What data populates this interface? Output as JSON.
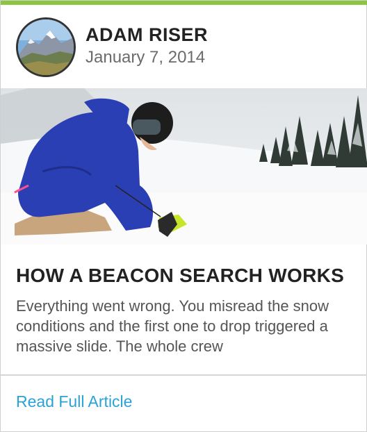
{
  "author": {
    "name": "ADAM RISER",
    "date": "January 7, 2014",
    "avatar_icon": "mountain-photo-avatar"
  },
  "post": {
    "hero_image": "skier-using-avalanche-beacon-photo",
    "title": "HOW A BEACON SEARCH WORKS",
    "excerpt": "Everything went wrong. You misread the snow conditions and the first one to drop triggered a massive slide. The whole crew"
  },
  "footer": {
    "read_more_label": "Read Full Article"
  },
  "colors": {
    "accent": "#8cc63f",
    "link": "#2aa2d6",
    "title": "#222222",
    "body_text": "#555555"
  }
}
